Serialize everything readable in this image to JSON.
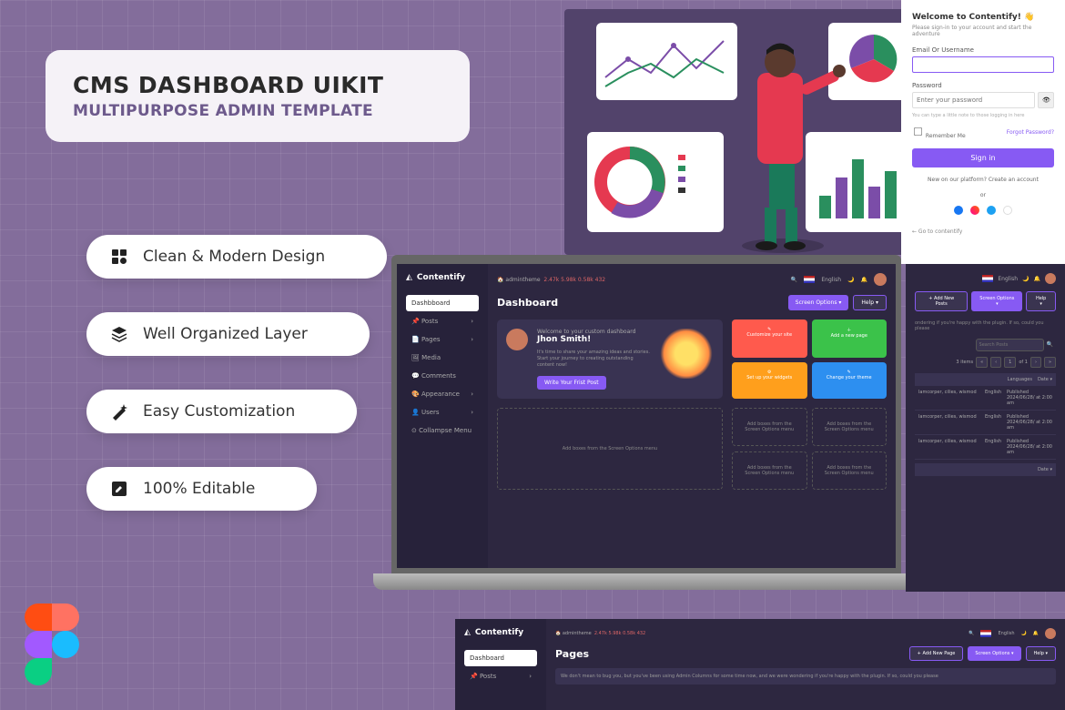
{
  "promo": {
    "title": "CMS DASHBOARD UIKIT",
    "subtitle": "MULTIPURPOSE ADMIN TEMPLATE",
    "features": [
      "Clean & Modern Design",
      "Well Organized Layer",
      "Easy Customization",
      "100% Editable"
    ]
  },
  "signin": {
    "title": "Welcome to Contentify! 👋",
    "subtitle": "Please sign-in to your account and start the adventure",
    "emailLabel": "Email Or Username",
    "passwordLabel": "Password",
    "passwordPh": "Enter your password",
    "note": "You can type a little note to those logging in here",
    "remember": "Remember Me",
    "forgot": "Forgot Password?",
    "signinBtn": "Sign in",
    "newUser": "New on our platform? Create an account",
    "or": "or",
    "back": "← Go to contentify"
  },
  "dashboard": {
    "brand": "Contentify",
    "home": "admintheme",
    "stats": "2.47k  5.98k  0.58k  432",
    "lang": "English",
    "pageTitle": "Dashboard",
    "screenOptions": "Screen Options ▾",
    "help": "Help ▾",
    "welcomeSub": "Welcome to your custom dashboard",
    "welcomeName": "Jhon Smith!",
    "welcomeDesc": "It's time to share your amazing ideas and stories. Start your journey to creating outstanding content now!",
    "writeBtn": "Write Your Frist Post",
    "tiles": [
      {
        "label": "Customize your site",
        "color": "#ff5a4d"
      },
      {
        "label": "Add a new page",
        "color": "#3bc24a"
      },
      {
        "label": "Set up your widgets",
        "color": "#ff9f1c"
      },
      {
        "label": "Change your theme",
        "color": "#2d8ff0"
      }
    ],
    "dropzoneBig": "Add boxes from the Screen Options menu",
    "dropzoneSmall": "Add boxes from the Screen Options menu",
    "nav": [
      "Dashbboard",
      "Posts",
      "Pages",
      "Media",
      "Comments",
      "Appearance",
      "Users",
      "Collampse Menu"
    ]
  },
  "posts": {
    "addNew": "+ Add New Posts",
    "hint": "ondering if you're happy with the plugin. If so, could you please",
    "searchPh": "Search Posts",
    "pager": "3 items",
    "of": "of 1",
    "cols": [
      "Languages",
      "Date ▾"
    ],
    "rows": [
      {
        "cat": "lamcorper, cilies, wismod",
        "lang": "English",
        "date": "Published 2024/06/28/ at 2:00 am"
      },
      {
        "cat": "lamcorper, cilies, wismod",
        "lang": "English",
        "date": "Published 2024/06/28/ at 2:00 am"
      },
      {
        "cat": "lamcorper, cilies, wismod",
        "lang": "English",
        "date": "Published 2024/06/28/ at 2:00 am"
      }
    ],
    "footer": "Date ▾"
  },
  "pages": {
    "title": "Pages",
    "addNew": "+ Add New Page",
    "nav": [
      "Dashboard",
      "Posts"
    ],
    "note": "We don't mean to bug you, but you've been using Admin Columns for some time now, and we were wondering if you're happy with the plugin. If so, could you please"
  },
  "icons": {
    "tile1": "✎",
    "tile2": "＋",
    "tile3": "⚙",
    "tile4": "✎"
  }
}
